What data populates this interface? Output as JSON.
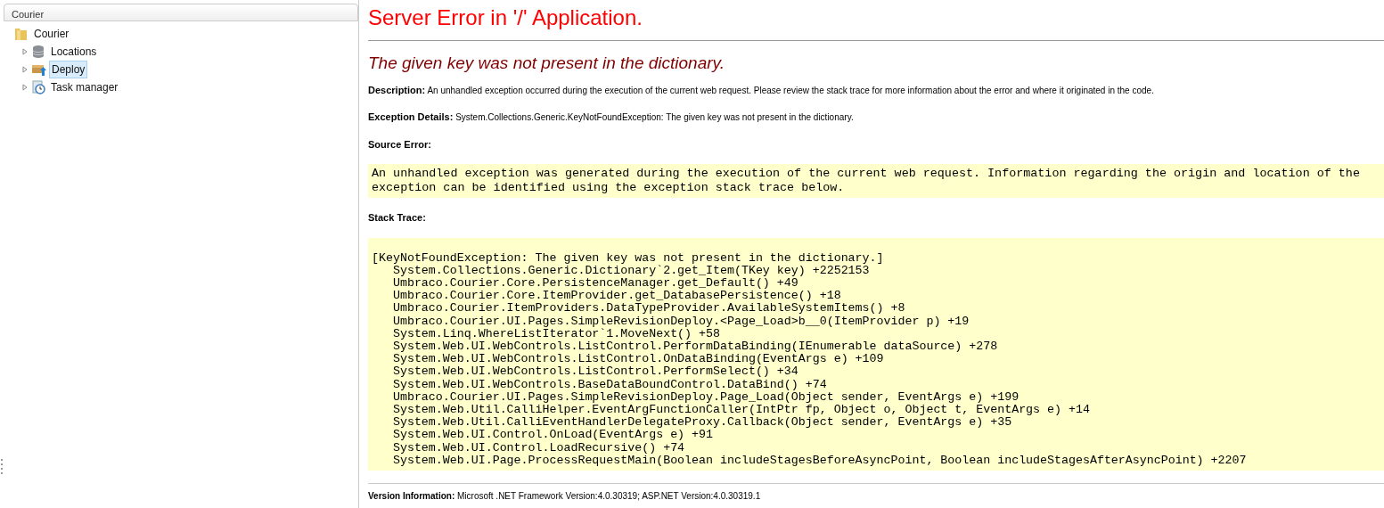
{
  "sidebar": {
    "title": "Courier",
    "tree": {
      "label": "Courier",
      "selected": false,
      "children": [
        {
          "label": "Locations",
          "kind": "database",
          "expanded": false,
          "selected": false
        },
        {
          "label": "Deploy",
          "kind": "deploy",
          "expanded": false,
          "selected": true
        },
        {
          "label": "Task manager",
          "kind": "clock",
          "expanded": false,
          "selected": false
        }
      ]
    }
  },
  "error": {
    "title": "Server Error in '/' Application.",
    "message": "The given key was not present in the dictionary.",
    "description": {
      "label": "Description:",
      "text": "An unhandled exception occurred during the execution of the current web request. Please review the stack trace for more information about the error and where it originated in the code."
    },
    "exception_details": {
      "label": "Exception Details:",
      "text": "System.Collections.Generic.KeyNotFoundException: The given key was not present in the dictionary."
    },
    "source_error": {
      "label": "Source Error:",
      "lines": [
        "An unhandled exception was generated during the execution of the current web request. Information regarding the origin and location of the",
        "exception can be identified using the exception stack trace below."
      ]
    },
    "stack_trace": {
      "label": "Stack Trace:",
      "lines": [
        "[KeyNotFoundException: The given key was not present in the dictionary.]",
        "   System.Collections.Generic.Dictionary`2.get_Item(TKey key) +2252153",
        "   Umbraco.Courier.Core.PersistenceManager.get_Default() +49",
        "   Umbraco.Courier.Core.ItemProvider.get_DatabasePersistence() +18",
        "   Umbraco.Courier.ItemProviders.DataTypeProvider.AvailableSystemItems() +8",
        "   Umbraco.Courier.UI.Pages.SimpleRevisionDeploy.<Page_Load>b__0(ItemProvider p) +19",
        "   System.Linq.WhereListIterator`1.MoveNext() +58",
        "   System.Web.UI.WebControls.ListControl.PerformDataBinding(IEnumerable dataSource) +278",
        "   System.Web.UI.WebControls.ListControl.OnDataBinding(EventArgs e) +109",
        "   System.Web.UI.WebControls.ListControl.PerformSelect() +34",
        "   System.Web.UI.WebControls.BaseDataBoundControl.DataBind() +74",
        "   Umbraco.Courier.UI.Pages.SimpleRevisionDeploy.Page_Load(Object sender, EventArgs e) +199",
        "   System.Web.Util.CalliHelper.EventArgFunctionCaller(IntPtr fp, Object o, Object t, EventArgs e) +14",
        "   System.Web.Util.CalliEventHandlerDelegateProxy.Callback(Object sender, EventArgs e) +35",
        "   System.Web.UI.Control.OnLoad(EventArgs e) +91",
        "   System.Web.UI.Control.LoadRecursive() +74",
        "   System.Web.UI.Page.ProcessRequestMain(Boolean includeStagesBeforeAsyncPoint, Boolean includeStagesAfterAsyncPoint) +2207"
      ]
    },
    "version": {
      "label": "Version Information:",
      "text": "Microsoft .NET Framework Version:4.0.30319; ASP.NET Version:4.0.30319.1"
    }
  }
}
